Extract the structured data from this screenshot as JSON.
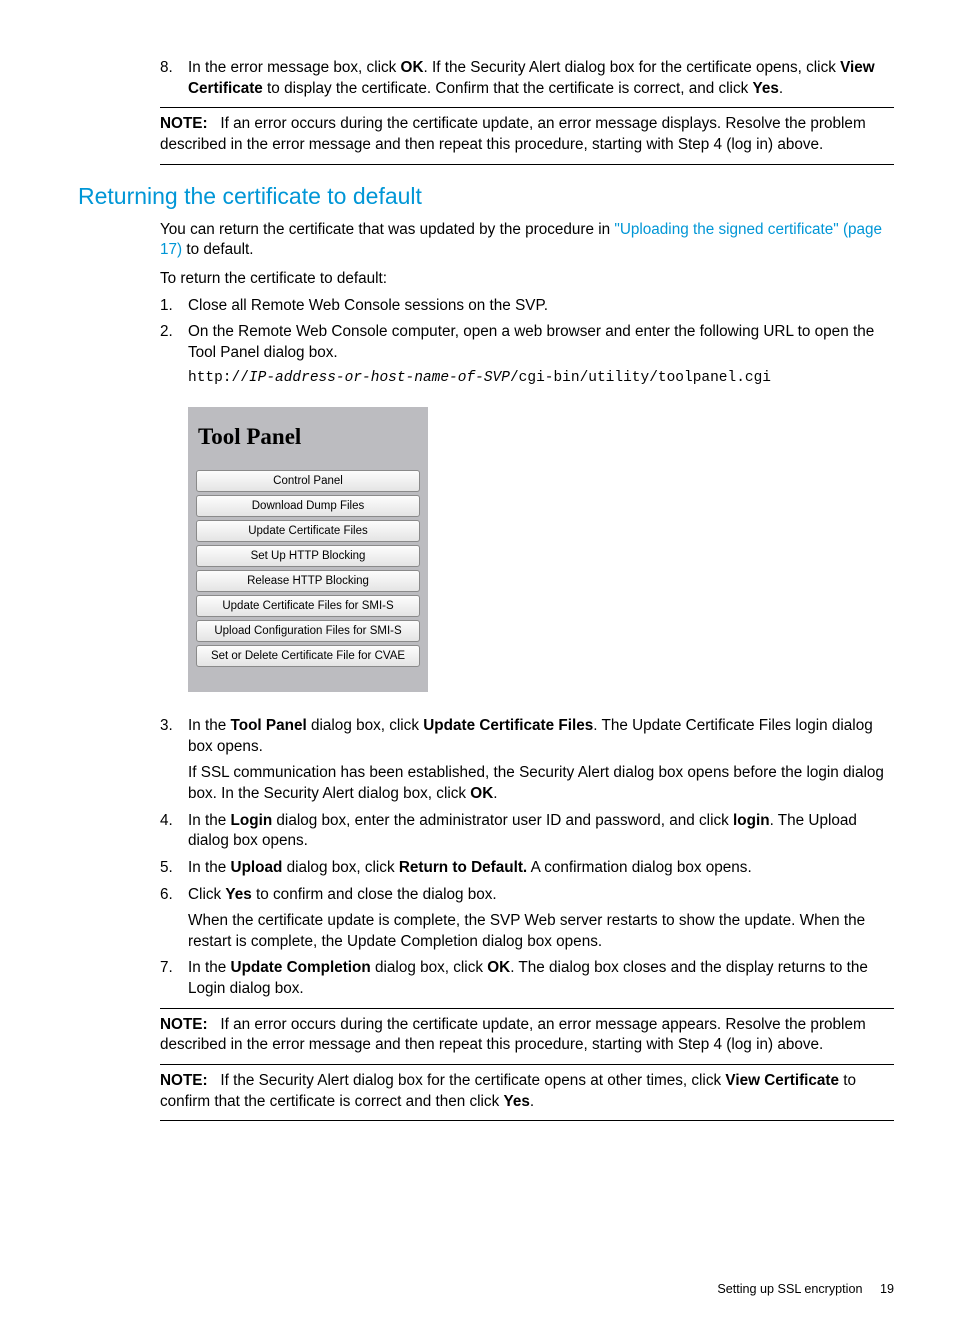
{
  "step8": {
    "num": "8.",
    "t1": "In the error message box, click ",
    "b1": "OK",
    "t2": ". If the Security Alert dialog box for the certificate opens, click ",
    "b2": "View Certificate",
    "t3": " to display the certificate. Confirm that the certificate is correct, and click ",
    "b3": "Yes",
    "t4": "."
  },
  "note1": {
    "label": "NOTE:",
    "body": "If an error occurs during the certificate update, an error message displays. Resolve the problem described in the error message and then repeat this procedure, starting with Step 4 (log in) above."
  },
  "section_title": "Returning the certificate to default",
  "intro": {
    "t1": "You can return the certificate that was updated by the procedure in ",
    "link": "\"Uploading the signed certificate\" (page 17)",
    "t2": " to default."
  },
  "intro2": "To return the certificate to default:",
  "steps": {
    "s1": {
      "num": "1.",
      "text": "Close all Remote Web Console sessions on the SVP."
    },
    "s2": {
      "num": "2.",
      "text": "On the Remote Web Console computer, open a web browser and enter the following URL to open the Tool Panel dialog box.",
      "code_pre": "http://",
      "code_it": "IP-address-or-host-name-of-SVP",
      "code_post": "/cgi-bin/utility/toolpanel.cgi"
    },
    "s3": {
      "num": "3.",
      "t1": "In the ",
      "b1": "Tool Panel",
      "t2": " dialog box, click ",
      "b2": "Update Certificate Files",
      "t3": ". The Update Certificate Files login dialog box opens.",
      "p2a": "If SSL communication has been established, the Security Alert dialog box opens before the login dialog box. In the Security Alert dialog box, click ",
      "p2b": "OK",
      "p2c": "."
    },
    "s4": {
      "num": "4.",
      "t1": "In the ",
      "b1": "Login",
      "t2": " dialog box, enter the administrator user ID and password, and click ",
      "b2": "login",
      "t3": ". The Upload dialog box opens."
    },
    "s5": {
      "num": "5.",
      "t1": "In the ",
      "b1": "Upload",
      "t2": " dialog box, click ",
      "b2": "Return to Default.",
      "t3": " A confirmation dialog box opens."
    },
    "s6": {
      "num": "6.",
      "t1": "Click ",
      "b1": "Yes",
      "t2": " to confirm and close the dialog box.",
      "p2": "When the certificate update is complete, the SVP Web server restarts to show the update. When the restart is complete, the Update Completion dialog box opens."
    },
    "s7": {
      "num": "7.",
      "t1": "In the ",
      "b1": "Update Completion",
      "t2": " dialog box, click ",
      "b2": "OK",
      "t3": ". The dialog box closes and the display returns to the Login dialog box."
    }
  },
  "tool_panel": {
    "title": "Tool Panel",
    "buttons": [
      "Control Panel",
      "Download Dump Files",
      "Update Certificate Files",
      "Set Up HTTP Blocking",
      "Release HTTP Blocking",
      "Update Certificate Files for SMI-S",
      "Upload Configuration Files for SMI-S",
      "Set or Delete Certificate File for CVAE"
    ]
  },
  "note2": {
    "label": "NOTE:",
    "body": "If an error occurs during the certificate update, an error message appears. Resolve the problem described in the error message and then repeat this procedure, starting with Step 4 (log in) above."
  },
  "note3": {
    "label": "NOTE:",
    "t1": "If the Security Alert dialog box for the certificate opens at other times, click ",
    "b1": "View Certificate",
    "t2": " to confirm that the certificate is correct and then click ",
    "b2": "Yes",
    "t3": "."
  },
  "footer": {
    "text": "Setting up SSL encryption",
    "page": "19"
  }
}
